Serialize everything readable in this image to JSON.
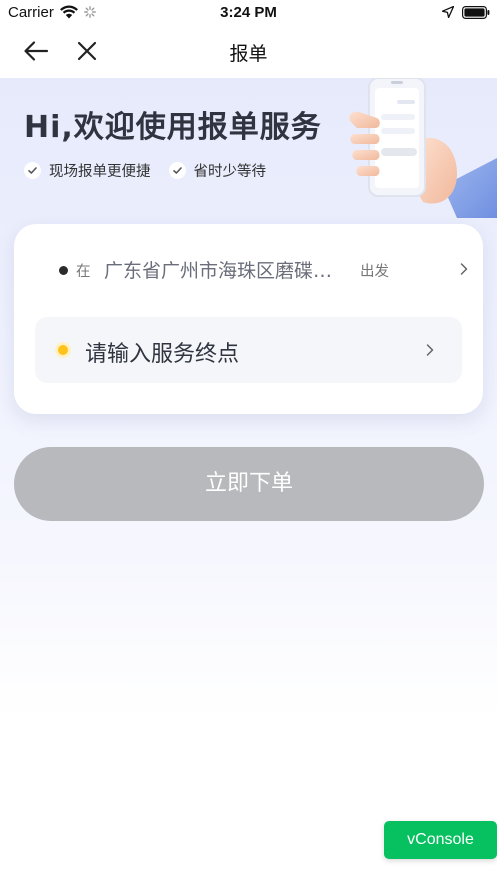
{
  "status_bar": {
    "carrier": "Carrier",
    "time": "3:24 PM"
  },
  "nav": {
    "title": "报单",
    "back_icon": "arrow-left",
    "close_icon": "x"
  },
  "hero": {
    "title": "Hi,欢迎使用报单服务",
    "features": [
      {
        "label": "现场报单更便捷"
      },
      {
        "label": "省时少等待"
      }
    ]
  },
  "origin": {
    "prefix": "在",
    "address": "广东省广州市海珠区磨碟…",
    "suffix": "出发"
  },
  "destination": {
    "placeholder": "请输入服务终点"
  },
  "submit": {
    "label": "立即下单"
  },
  "vconsole": {
    "label": "vConsole"
  },
  "colors": {
    "accent_yellow": "#ffc21a",
    "button_disabled": "#b8b9bd",
    "vconsole_green": "#07c160"
  }
}
